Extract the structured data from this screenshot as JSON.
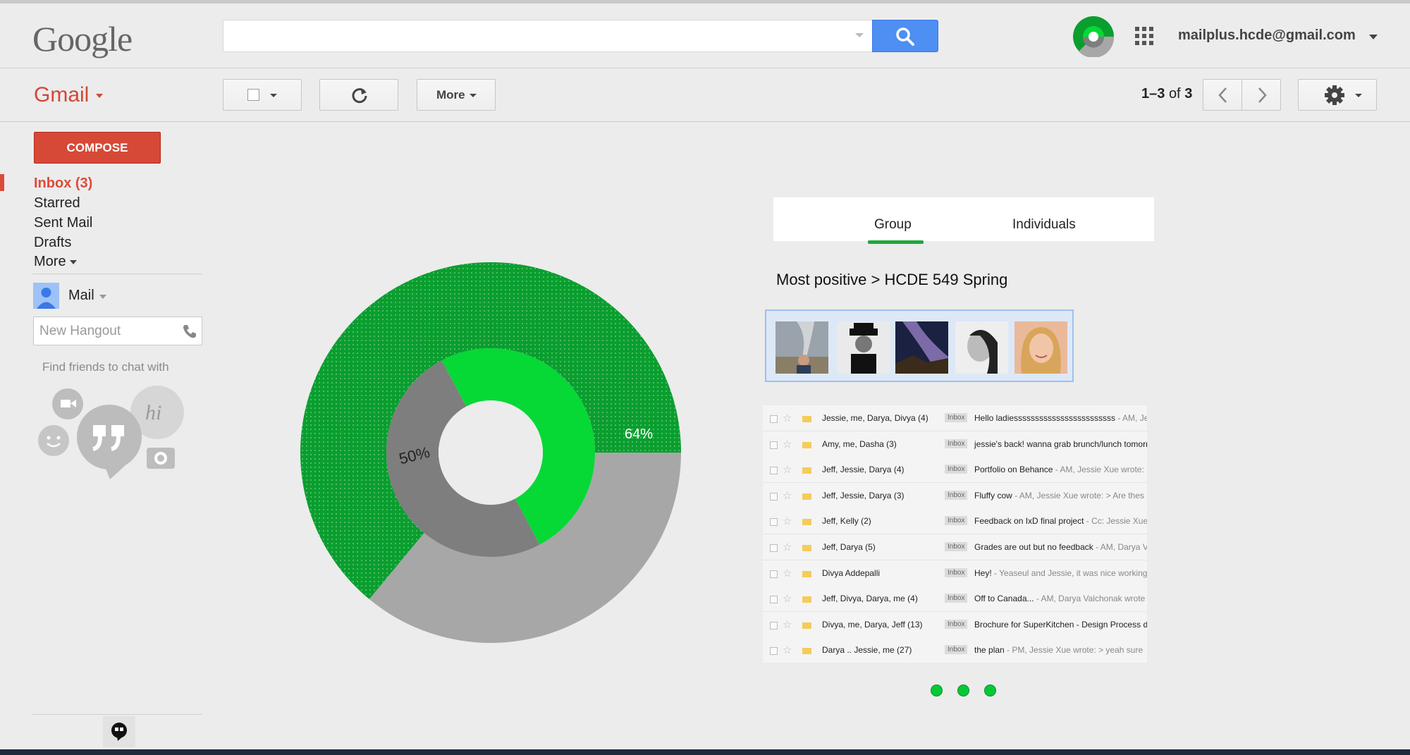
{
  "header": {
    "logo": "Google",
    "search_placeholder": "",
    "account": "mailplus.hcde@gmail.com"
  },
  "toolbar": {
    "app": "Gmail",
    "more_label": "More",
    "pager_range": "1–3",
    "pager_of": "of",
    "pager_total": "3"
  },
  "sidebar": {
    "compose": "COMPOSE",
    "items": [
      "Inbox (3)",
      "Starred",
      "Sent Mail",
      "Drafts",
      "More"
    ],
    "mail_label": "Mail",
    "hangout_placeholder": "New Hangout",
    "find_friends": "Find friends to chat with"
  },
  "chart_data": {
    "type": "pie",
    "rings": [
      {
        "name": "",
        "values": [
          64,
          36
        ],
        "colors": [
          "#0a9e2f",
          "#a7a7a7"
        ],
        "label": "64%"
      },
      {
        "name": "",
        "values": [
          50,
          50
        ],
        "colors": [
          "#06d836",
          "#7e7e7e"
        ],
        "label": "50%"
      }
    ]
  },
  "panel": {
    "tabs": [
      "Group",
      "Individuals"
    ],
    "active_tab": "Group",
    "title": "Most positive > HCDE 549 Spring",
    "emails": [
      {
        "sender": "Jessie, me, Darya, Divya (4)",
        "label": "Inbox",
        "subject": "Hello ladiessssssssssssssssssssssss",
        "snippet": " - AM, Je"
      },
      {
        "sender": "Amy, me, Dasha (3)",
        "label": "Inbox",
        "subject": "jessie's back! wanna grab brunch/lunch tomorr",
        "snippet": ""
      },
      {
        "sender": "Jeff, Jessie, Darya (4)",
        "label": "Inbox",
        "subject": "Portfolio on Behance",
        "snippet": " - AM, Jessie Xue wrote:"
      },
      {
        "sender": "Jeff, Jessie, Darya (3)",
        "label": "Inbox",
        "subject": "Fluffy cow",
        "snippet": " - AM, Jessie Xue wrote: > Are thes"
      },
      {
        "sender": "Jeff, Kelly (2)",
        "label": "Inbox",
        "subject": "Feedback on IxD final project",
        "snippet": " - Cc: Jessie Xue"
      },
      {
        "sender": "Jeff, Darya (5)",
        "label": "Inbox",
        "subject": "Grades are out but no feedback",
        "snippet": " - AM, Darya V"
      },
      {
        "sender": "Divya Addepalli",
        "label": "Inbox",
        "subject": "Hey!",
        "snippet": " - Yeaseul and Jessie, it was nice working"
      },
      {
        "sender": "Jeff, Divya, Darya, me (4)",
        "label": "Inbox",
        "subject": "Off to Canada...",
        "snippet": " - AM, Darya Valchonak wrote"
      },
      {
        "sender": "Divya, me, Darya, Jeff (13)",
        "label": "Inbox",
        "subject": "Brochure for SuperKitchen - Design Process d",
        "snippet": ""
      },
      {
        "sender": "Darya .. Jessie, me (27)",
        "label": "Inbox",
        "subject": "the plan",
        "snippet": " - PM, Jessie Xue wrote: > yeah sure"
      }
    ]
  },
  "colors": {
    "accent": "#dd4b39",
    "search": "#4d8ff2",
    "green": "#06d836"
  }
}
